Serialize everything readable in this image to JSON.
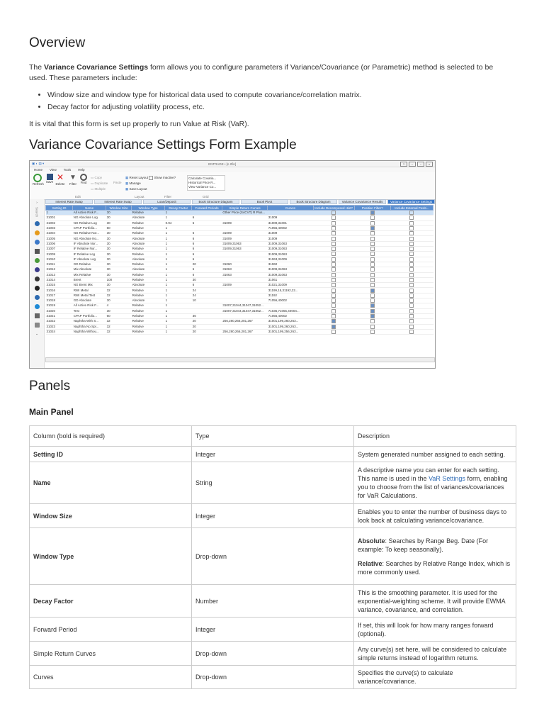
{
  "overview": {
    "heading": "Overview",
    "intro_pre": "The ",
    "intro_bold": "Variance Covariance Settings",
    "intro_post": " form allows you to configure parameters if Variance/Covariance (or Parametric) method is selected to be used. These parameters include:",
    "bullets": [
      "Window size and window type for historical data used to compute covariance/correlation matrix.",
      "Decay factor for adjusting volatility process, etc."
    ],
    "vital": "It is vital that this form is set up properly to run Value at Risk (VaR)."
  },
  "example": {
    "heading": "Variance Covariance Settings Form Example",
    "app_title": "ENTRADE • [n 2fin]",
    "menu": [
      "Home",
      "View",
      "Tools",
      "Help"
    ],
    "ribbon": {
      "refresh": "Refresh",
      "save": "Save",
      "delete": "Delete",
      "filter": "Filter",
      "find": "Find",
      "copy": "Copy",
      "duplicate": "Duplicate",
      "multiple": "Multiple",
      "paste": "Paste",
      "reset_layout": "Reset Layout",
      "manage": "Manage",
      "save_layout": "Save Layout",
      "show_inactive": "Show Inactive?",
      "grid_items": [
        "Calculate Covaria...",
        "Historical Price R...",
        "View Variance Co..."
      ],
      "group_edit": "Edit",
      "group_layout": "Layout",
      "group_filter": "Filter",
      "group_grid": "Grid"
    },
    "tabs": [
      "Interest Rate Swap",
      "Interest Rate Swap",
      "Loan/Deposit",
      "Book Structure Diagram",
      "Book Pivot",
      "Book Structure Diagram",
      "Variance Covariance Results",
      "Variance Covariance Settings"
    ],
    "columns": [
      "Setting ID",
      "Name",
      "Window Size",
      "Window Type",
      "Decay Factor",
      "Forward Periods",
      "Simple Return Curves",
      "Curves",
      "Include Decomposed Hist?",
      "Position Filter?",
      "Include External Positi..."
    ],
    "rows": [
      [
        "1",
        "All Active Risk F...",
        "30",
        "Relative",
        "1",
        "",
        "Other Price (S4CVT) R Plus...",
        "",
        "",
        "✓",
        ""
      ],
      [
        "31001",
        "NG Absolute Log",
        "30",
        "Absolute",
        "1",
        "6",
        "",
        "31009",
        "",
        "",
        ""
      ],
      [
        "31002",
        "NG Relative Log",
        "30",
        "Relative",
        "0.94",
        "6",
        "31009",
        "31009,31001",
        "",
        "",
        ""
      ],
      [
        "31003",
        "CPAP Portfolio...",
        "60",
        "Relative",
        "1",
        "",
        "",
        "71056,40002",
        "",
        "✓",
        ""
      ],
      [
        "31004",
        "NG Relative Nor...",
        "30",
        "Relative",
        "1",
        "6",
        "31009",
        "31009",
        "",
        "",
        ""
      ],
      [
        "31005",
        "NG Absolute No...",
        "30",
        "Absolute",
        "1",
        "6",
        "31009",
        "31009",
        "",
        "",
        ""
      ],
      [
        "31006",
        "IF Absolute Nor...",
        "30",
        "Absolute",
        "1",
        "6",
        "31009,31063",
        "31009,31063",
        "",
        "",
        ""
      ],
      [
        "31007",
        "IF Relative Nor...",
        "30",
        "Relative",
        "1",
        "6",
        "31009,31063",
        "31009,31063",
        "",
        "",
        ""
      ],
      [
        "31009",
        "IF Relative Log",
        "30",
        "Relative",
        "1",
        "6",
        "",
        "31009,31063",
        "",
        "",
        ""
      ],
      [
        "31010",
        "IF Absolute Log",
        "30",
        "Absolute",
        "1",
        "6",
        "",
        "31063,31009",
        "",
        "",
        ""
      ],
      [
        "31011",
        "GD Relative",
        "30",
        "Relative",
        "1",
        "20",
        "31060",
        "31060",
        "",
        "",
        ""
      ],
      [
        "31012",
        "Mix Absolute",
        "30",
        "Absolute",
        "1",
        "6",
        "31063",
        "31009,31063",
        "",
        "",
        ""
      ],
      [
        "31013",
        "Mix Relative",
        "30",
        "Relative",
        "1",
        "6",
        "31063",
        "31009,31063",
        "",
        "",
        ""
      ],
      [
        "31014",
        "Brent",
        "100",
        "Relative",
        "1",
        "30",
        "",
        "31061",
        "",
        "",
        ""
      ],
      [
        "31015",
        "NG Brent Mix",
        "30",
        "Absolute",
        "1",
        "6",
        "31009",
        "31021,31009",
        "",
        "",
        ""
      ],
      [
        "31016",
        "RWI Metal",
        "32",
        "Relative",
        "1",
        "24",
        "",
        "31199,15,31192,22...",
        "",
        "✓",
        ""
      ],
      [
        "31017",
        "RWI Metal Test",
        "32",
        "Relative",
        "1",
        "24",
        "",
        "31192",
        "",
        "",
        ""
      ],
      [
        "31018",
        "GD Absolute",
        "30",
        "Absolute",
        "1",
        "10",
        "",
        "71056,40002",
        "",
        "",
        ""
      ],
      [
        "31019",
        "All Active Risk F...",
        "4",
        "Relative",
        "1",
        "",
        "31007,31044,31047,31052...",
        "",
        "",
        "✓",
        ""
      ],
      [
        "31020",
        "Test",
        "30",
        "Relative",
        "1",
        "",
        "31007,31044,31047,31052...",
        "71035,71055,40004...",
        "",
        "✓",
        ""
      ],
      [
        "31021",
        "CPAP Portfolio...",
        "60",
        "Relative",
        "1",
        "36",
        "",
        "71056,40002",
        "",
        "✓",
        ""
      ],
      [
        "31022",
        "Naphtha With S...",
        "32",
        "Relative",
        "1",
        "20",
        "256,280,266,281,267",
        "31001,199,260,263...",
        "✓",
        "",
        ""
      ],
      [
        "31023",
        "Naphtha No Spr...",
        "32",
        "Relative",
        "1",
        "20",
        "",
        "31001,199,260,263...",
        "✓",
        "",
        ""
      ],
      [
        "31024",
        "Naphtha Withou...",
        "32",
        "Relative",
        "1",
        "20",
        "256,280,266,281,267",
        "31001,199,256,263...",
        "",
        "",
        ""
      ]
    ]
  },
  "panels": {
    "heading": "Panels",
    "main_heading": "Main Panel",
    "table_headers": [
      "Column (bold is required)",
      "Type",
      "Description"
    ],
    "rows": [
      {
        "column": "Setting ID",
        "bold": true,
        "type": "Integer",
        "desc": "System generated number assigned to each setting."
      },
      {
        "column": "Name",
        "bold": true,
        "type": "String",
        "desc_pre": "A descriptive name you can enter for each setting. This name is used in the ",
        "desc_link": "VaR Settings",
        "desc_post": " form, enabling you to choose from the list of variances/covariances for VaR Calculations."
      },
      {
        "column": "Window Size",
        "bold": true,
        "type": "Integer",
        "desc": "Enables you to enter the number of business days to look back at calculating variance/covariance."
      },
      {
        "column": "Window Type",
        "bold": true,
        "type": "Drop-down",
        "abs_label": "Absolute",
        "abs_text": ": Searches by Range Beg. Date (For example: To keep seasonally).",
        "rel_label": "Relative",
        "rel_text": ": Searches by Relative Range Index, which is more commonly used."
      },
      {
        "column": "Decay Factor",
        "bold": true,
        "type": "Number",
        "desc": "This is the smoothing parameter. It is used for the exponential-weighting scheme. It will provide EWMA variance, covariance, and correlation."
      },
      {
        "column": "Forward Period",
        "bold": false,
        "type": "Integer",
        "desc": "If set, this will look for how many ranges forward (optional)."
      },
      {
        "column": "Simple Return Curves",
        "bold": false,
        "type": "Drop-down",
        "desc": "Any curve(s) set here, will be considered to calculate simple returns instead of logarithm returns."
      },
      {
        "column": "Curves",
        "bold": false,
        "type": "Drop-down",
        "desc": "Specifies the curve(s) to calculate variance/covariance."
      }
    ]
  }
}
